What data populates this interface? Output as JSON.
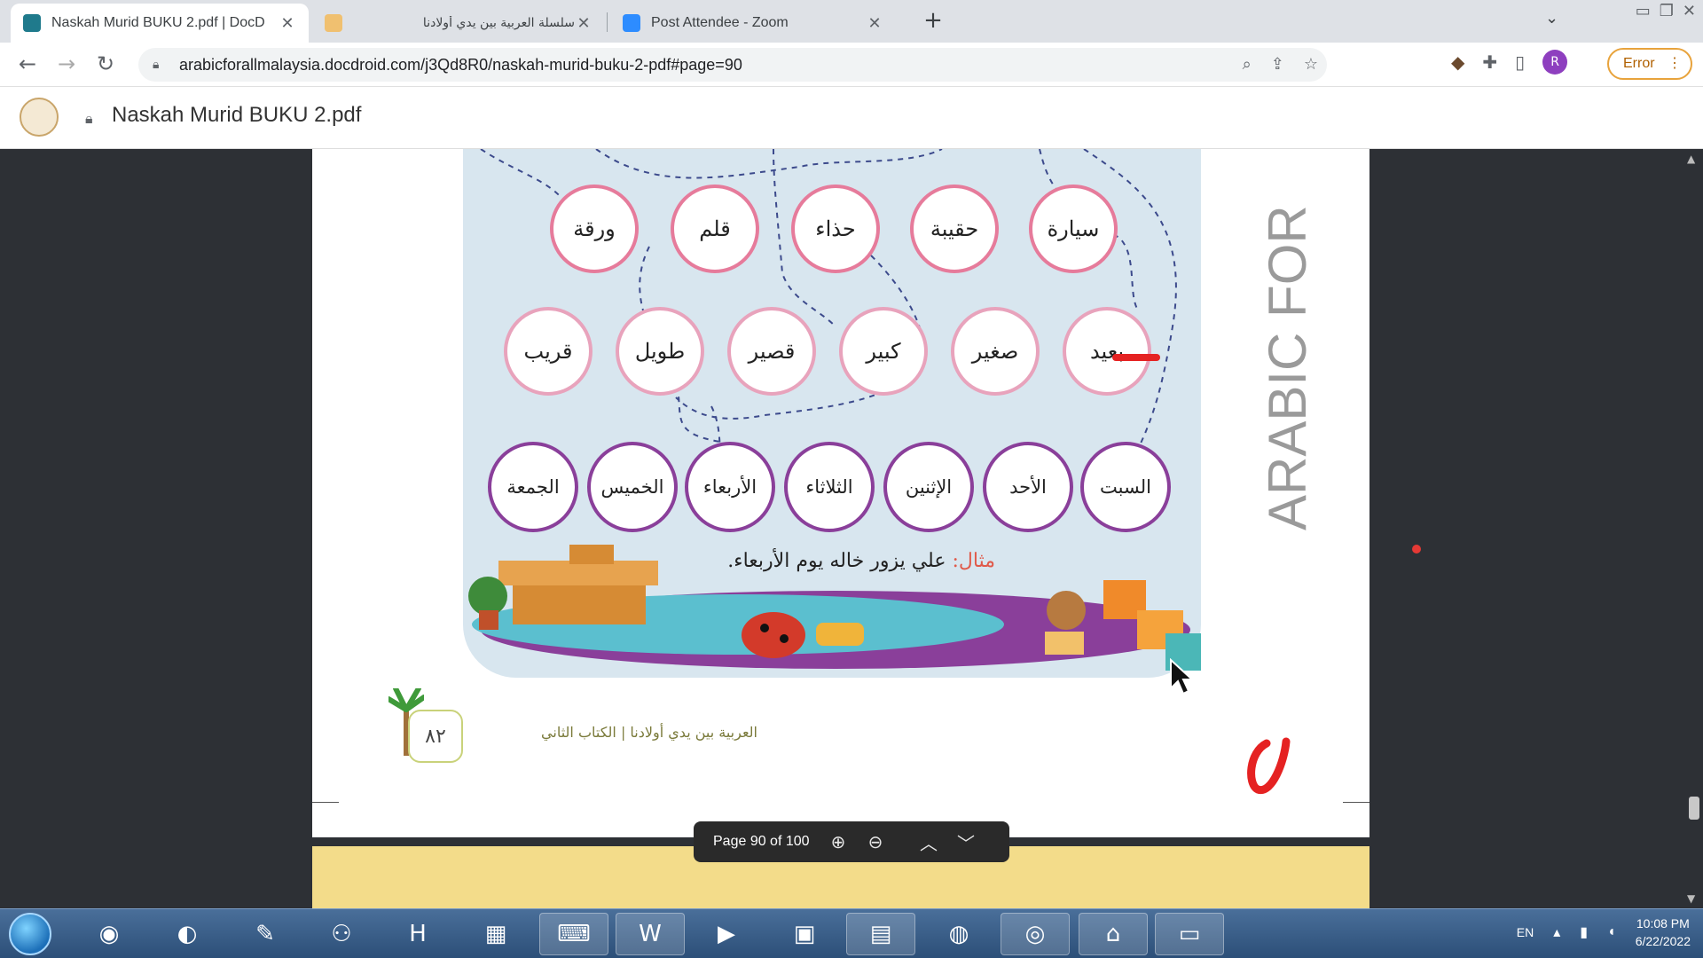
{
  "browser": {
    "tabs": [
      {
        "title": "Naskah Murid BUKU 2.pdf | DocD",
        "active": true
      },
      {
        "title": "سلسلة العربية بين يدي أولادنا",
        "active": false
      },
      {
        "title": "Post Attendee - Zoom",
        "active": false
      }
    ],
    "url": "arabicforallmalaysia.docdroid.com/j3Qd8R0/naskah-murid-buku-2-pdf#page=90",
    "error_label": "Error",
    "avatar_letter": "R"
  },
  "viewer": {
    "title": "Naskah Murid BUKU 2.pdf",
    "page_indicator": "Page 90 of 100"
  },
  "page": {
    "side_text": "ARABIC FOR",
    "row1": [
      "ورقة",
      "قلم",
      "حذاء",
      "حقيبة",
      "سيارة"
    ],
    "row2": [
      "قريب",
      "طويل",
      "قصير",
      "كبير",
      "صغير",
      "بعيد"
    ],
    "row3": [
      "الجمعة",
      "الخميس",
      "الأربعاء",
      "الثلاثاء",
      "الإثنين",
      "الأحد",
      "السبت"
    ],
    "example_label": "مثال:",
    "example_text": "علي يزور خاله يوم الأربعاء.",
    "page_number": "٨٢",
    "footer_text": "العربية بين يدي أولادنا | الكتاب الثاني"
  },
  "taskbar": {
    "lang": "EN",
    "time": "10:08 PM",
    "date": "6/22/2022"
  }
}
